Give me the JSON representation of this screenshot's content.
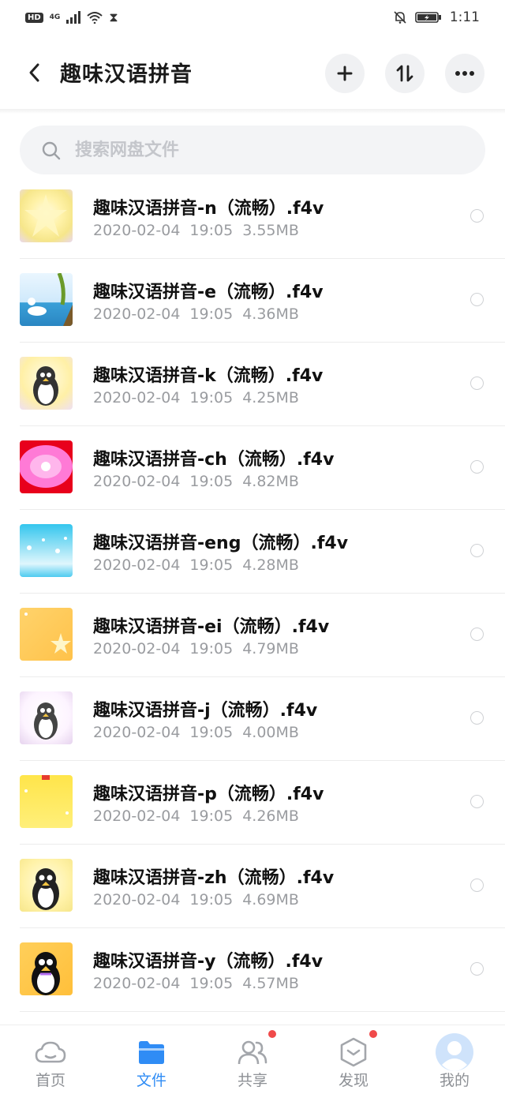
{
  "status_bar": {
    "hd": "HD",
    "network": "4G",
    "time": "1:11"
  },
  "header": {
    "title": "趣味汉语拼音",
    "icons": [
      "back-icon",
      "plus-icon",
      "sort-icon",
      "more-icon"
    ]
  },
  "search": {
    "placeholder": "搜索网盘文件"
  },
  "files": [
    {
      "name": "趣味汉语拼音-n（流畅）.f4v",
      "date": "2020-02-04",
      "time": "19:05",
      "size": "3.55MB"
    },
    {
      "name": "趣味汉语拼音-e（流畅）.f4v",
      "date": "2020-02-04",
      "time": "19:05",
      "size": "4.36MB"
    },
    {
      "name": "趣味汉语拼音-k（流畅）.f4v",
      "date": "2020-02-04",
      "time": "19:05",
      "size": "4.25MB"
    },
    {
      "name": "趣味汉语拼音-ch（流畅）.f4v",
      "date": "2020-02-04",
      "time": "19:05",
      "size": "4.82MB"
    },
    {
      "name": "趣味汉语拼音-eng（流畅）.f4v",
      "date": "2020-02-04",
      "time": "19:05",
      "size": "4.28MB"
    },
    {
      "name": "趣味汉语拼音-ei（流畅）.f4v",
      "date": "2020-02-04",
      "time": "19:05",
      "size": "4.79MB"
    },
    {
      "name": "趣味汉语拼音-j（流畅）.f4v",
      "date": "2020-02-04",
      "time": "19:05",
      "size": "4.00MB"
    },
    {
      "name": "趣味汉语拼音-p（流畅）.f4v",
      "date": "2020-02-04",
      "time": "19:05",
      "size": "4.26MB"
    },
    {
      "name": "趣味汉语拼音-zh（流畅）.f4v",
      "date": "2020-02-04",
      "time": "19:05",
      "size": "4.69MB"
    },
    {
      "name": "趣味汉语拼音-y（流畅）.f4v",
      "date": "2020-02-04",
      "time": "19:05",
      "size": "4.57MB"
    }
  ],
  "nav": [
    {
      "label": "首页",
      "icon": "cloud-icon",
      "active": false,
      "badge": false
    },
    {
      "label": "文件",
      "icon": "folder-icon",
      "active": true,
      "badge": false
    },
    {
      "label": "共享",
      "icon": "users-icon",
      "active": false,
      "badge": true
    },
    {
      "label": "发现",
      "icon": "cube-icon",
      "active": false,
      "badge": true
    },
    {
      "label": "我的",
      "icon": "avatar-icon",
      "active": false,
      "badge": false
    }
  ],
  "colors": {
    "accent": "#2f8cf5",
    "badge": "#f04a4a",
    "meta_text": "#9a9ca0"
  }
}
